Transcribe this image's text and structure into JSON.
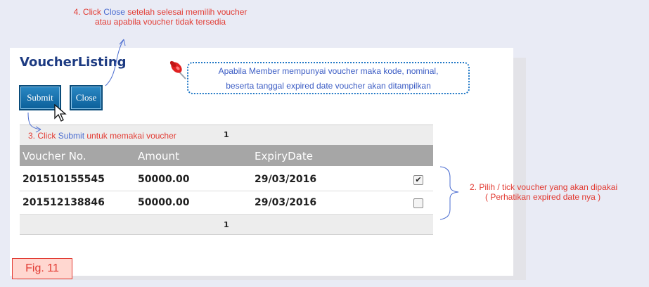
{
  "voucher_listing_title": "VoucherListing",
  "buttons": {
    "submit": "Submit",
    "close": "Close"
  },
  "notes": {
    "note4_prefix": "4. Click ",
    "note4_close": "Close",
    "note4_rest": " setelah selesai memilih voucher",
    "note4_line2": "atau apabila voucher tidak tersedia",
    "callout_line1": "Apabila Member mempunyai voucher maka kode, nominal,",
    "callout_line2": "beserta tanggal expired date voucher akan ditampilkan",
    "note3_prefix": "3. Click ",
    "note3_submit": "Submit",
    "note3_rest": " untuk memakai voucher",
    "note2_line1": "2. Pilih / tick voucher yang akan dipakai",
    "note2_line2": "( Perhatikan expired date nya )"
  },
  "pager": {
    "current_page": "1"
  },
  "table": {
    "columns": [
      "Voucher No.",
      "Amount",
      "ExpiryDate"
    ],
    "rows": [
      {
        "voucher_no": "201510155545",
        "amount": "50000.00",
        "expiry": "29/03/2016",
        "checked": true
      },
      {
        "voucher_no": "201512138846",
        "amount": "50000.00",
        "expiry": "29/03/2016",
        "checked": false
      }
    ]
  },
  "figure_label": "Fig. 11",
  "icons": [
    "pushpin-icon",
    "mouse-cursor-icon",
    "checkbox-icon"
  ]
}
